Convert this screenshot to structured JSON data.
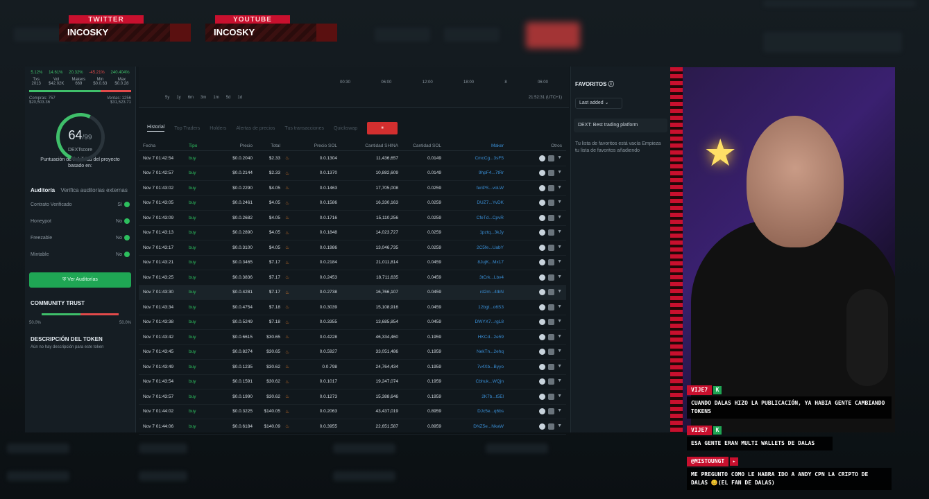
{
  "overlays": {
    "twitter": {
      "label": "TWITTER",
      "name": "INCOSKY"
    },
    "youtube": {
      "label": "YOUTUBE",
      "name": "INCOSKY"
    }
  },
  "left_panel": {
    "stats": [
      "5.12%",
      "14.61%",
      "20.32%",
      "-45.21%",
      "240.404%"
    ],
    "kv": [
      {
        "k": "Txs",
        "v": "2013"
      },
      {
        "k": "Vol",
        "v": "$42.02K"
      },
      {
        "k": "Makers",
        "v": "669"
      },
      {
        "k": "Min",
        "v": "$0.0.63"
      },
      {
        "k": "Max",
        "v": "$0.0.28"
      }
    ],
    "buys_label": "Compras: 757",
    "buys_value": "$20,503.36",
    "sells_label": "Ventas: 1256",
    "sells_value": "$31,523.71",
    "score": "64",
    "score_max": "/99",
    "score_name": "DEXTscore",
    "score_desc": "Puntuación de fiabilidad del proyecto basado en:",
    "audit_title": "Auditoría",
    "audit_link": "Verifica auditorías externas",
    "audits": [
      {
        "label": "Contrato Verificado",
        "value": "Sí"
      },
      {
        "label": "Honeypot",
        "value": "No"
      },
      {
        "label": "Freezable",
        "value": "No"
      },
      {
        "label": "Mintable",
        "value": "No"
      }
    ],
    "audit_button": "Ver Auditorías",
    "community_title": "COMMUNITY TRUST",
    "trust_left": "50.0%",
    "trust_right": "50.0%",
    "description_title": "DESCRIPCIÓN DEL TOKEN",
    "description_text": "Aún no hay descripción para este token"
  },
  "chart": {
    "times": [
      "00:30",
      "06:00",
      "12:00",
      "18:00",
      "8",
      "06:00"
    ],
    "timeframes": [
      "5y",
      "1y",
      "6m",
      "3m",
      "1m",
      "5d",
      "1d"
    ],
    "clock": "21:52:31 (UTC+1)"
  },
  "tabs": [
    "Historial",
    "Top Traders",
    "Holders",
    "Alertas de precios",
    "Tus transacciones",
    "Quickswap"
  ],
  "table": {
    "headers": [
      "Fecha",
      "Tipo",
      "Precio",
      "Total",
      "",
      "Precio SOL",
      "Cantidad SHINA",
      "Cantidad SOL",
      "Maker",
      "Otros"
    ],
    "rows": [
      [
        "Nov 7 01:42:54",
        "buy",
        "$0.0.2040",
        "$2.33",
        "0.0.1304",
        "11,436,657",
        "0.0149",
        "CmcCg...3sF5"
      ],
      [
        "Nov 7 01:42:57",
        "buy",
        "$0.0.2144",
        "$2.33",
        "0.0.1370",
        "10,882,609",
        "0.0149",
        "9hpF4...7tRr"
      ],
      [
        "Nov 7 01:43:02",
        "buy",
        "$0.0.2290",
        "$4.05",
        "0.0.1463",
        "17,705,008",
        "0.0259",
        "feriPS...voLW"
      ],
      [
        "Nov 7 01:43:05",
        "buy",
        "$0.0.2461",
        "$4.05",
        "0.0.1586",
        "16,330,163",
        "0.0259",
        "DUZ7...YvDK"
      ],
      [
        "Nov 7 01:43:09",
        "buy",
        "$0.0.2682",
        "$4.05",
        "0.0.1716",
        "15,110,256",
        "0.0259",
        "CfeTd...CpvR"
      ],
      [
        "Nov 7 01:43:13",
        "buy",
        "$0.0.2890",
        "$4.05",
        "0.0.1848",
        "14,023,727",
        "0.0259",
        "1pztq...3kJy"
      ],
      [
        "Nov 7 01:43:17",
        "buy",
        "$0.0.3100",
        "$4.05",
        "0.0.1986",
        "13,046,735",
        "0.0259",
        "2C5fe...UabY"
      ],
      [
        "Nov 7 01:43:21",
        "buy",
        "$0.0.3465",
        "$7.17",
        "0.0.2184",
        "21,011,814",
        "0.0459",
        "8JujK...Mx17"
      ],
      [
        "Nov 7 01:43:25",
        "buy",
        "$0.0.3836",
        "$7.17",
        "0.0.2453",
        "18,711,635",
        "0.0459",
        "3tCrk...Lbv4"
      ],
      [
        "Nov 7 01:43:30",
        "buy",
        "$0.0.4281",
        "$7.17",
        "0.0.2738",
        "16,766,107",
        "0.0459",
        "rd2m...4tbN"
      ],
      [
        "Nov 7 01:43:34",
        "buy",
        "$0.0.4754",
        "$7.18",
        "0.0.3039",
        "15,108,916",
        "0.0459",
        "12bgt...o6S3"
      ],
      [
        "Nov 7 01:43:38",
        "buy",
        "$0.0.5249",
        "$7.18",
        "0.0.3355",
        "13,685,854",
        "0.0459",
        "DWYX7...rgL8"
      ],
      [
        "Nov 7 01:43:42",
        "buy",
        "$0.0.6615",
        "$30.65",
        "0.0.4228",
        "46,334,460",
        "0.1959",
        "HKCd...2e59"
      ],
      [
        "Nov 7 01:43:45",
        "buy",
        "$0.0.8274",
        "$30.65",
        "0.0.5927",
        "33,051,486",
        "0.1959",
        "NekTn...2ehq"
      ],
      [
        "Nov 7 01:43:49",
        "buy",
        "$0.0.1235",
        "$30.62",
        "0.0.798",
        "24,764,434",
        "0.1959",
        "7v4Xb...Byyo"
      ],
      [
        "Nov 7 01:43:54",
        "buy",
        "$0.0.1591",
        "$30.62",
        "0.0.1017",
        "19,247,074",
        "0.1959",
        "Cbhuk...WQjn"
      ],
      [
        "Nov 7 01:43:57",
        "buy",
        "$0.0.1990",
        "$30.62",
        "0.0.1273",
        "15,388,646",
        "0.1959",
        "2K7b...t5El"
      ],
      [
        "Nov 7 01:44:02",
        "buy",
        "$0.0.3225",
        "$140.05",
        "0.0.2063",
        "43,437,019",
        "0.8959",
        "DJc5e...q6bs"
      ],
      [
        "Nov 7 01:44:06",
        "buy",
        "$0.0.6184",
        "$140.09",
        "0.0.3955",
        "22,651,587",
        "0.8959",
        "DNZ5e...NkaW"
      ]
    ]
  },
  "favorites": {
    "title": "FAVORITOS",
    "sort": "Last added",
    "item": "DEXT: Best trading platform",
    "empty": "Tu lista de favoritos está vacía Empieza tu lista de favoritos añadiendo"
  },
  "chat": [
    {
      "user": "VIJE7",
      "badge": "K",
      "msg": "CUANDO DALAS HIZO LA PUBLICACIÓN, YA HABIA GENTE CAMBIANDO TOKENS"
    },
    {
      "user": "VIJE7",
      "badge": "K",
      "msg": "ESA GENTE ERAN MULTI WALLETS DE DALAS"
    },
    {
      "user": "@MISTOUNGT",
      "badge": "▸",
      "msg": "ME PREGUNTO COMO LE HABRA IDO A ANDY CPN LA CRIPTO DE DALAS 😊(EL FAN DE DALAS)"
    }
  ],
  "colors": {
    "accent_red": "#c8102e",
    "buy_green": "#2dbf5e",
    "maker_blue": "#3a8fd6"
  }
}
